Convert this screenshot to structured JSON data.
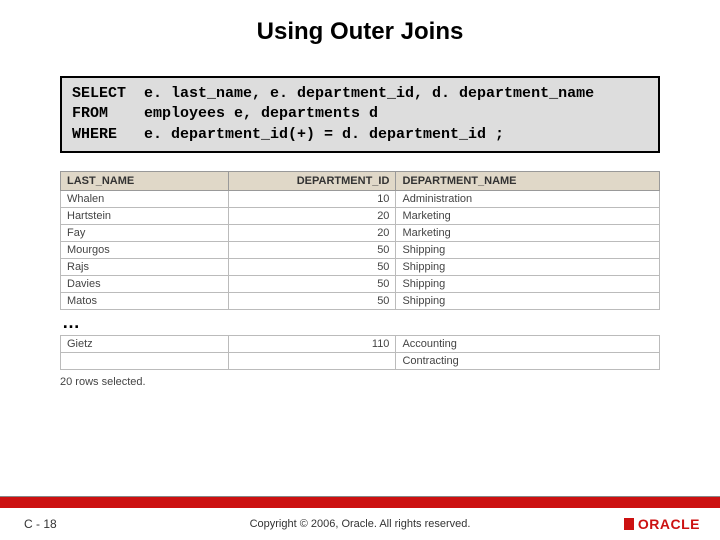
{
  "title": "Using Outer Joins",
  "sql": {
    "select_kw": "SELECT",
    "select_body": "e. last_name, e. department_id, d. department_name",
    "from_kw": "FROM",
    "from_body": "employees e, departments d",
    "where_kw": "WHERE",
    "where_body": "e. department_id(+) = d. department_id ;"
  },
  "chart_data": {
    "type": "table",
    "columns": [
      "LAST_NAME",
      "DEPARTMENT_ID",
      "DEPARTMENT_NAME"
    ],
    "rows_top": [
      {
        "last_name": "Whalen",
        "department_id": 10,
        "department_name": "Administration"
      },
      {
        "last_name": "Hartstein",
        "department_id": 20,
        "department_name": "Marketing"
      },
      {
        "last_name": "Fay",
        "department_id": 20,
        "department_name": "Marketing"
      },
      {
        "last_name": "Mourgos",
        "department_id": 50,
        "department_name": "Shipping"
      },
      {
        "last_name": "Rajs",
        "department_id": 50,
        "department_name": "Shipping"
      },
      {
        "last_name": "Davies",
        "department_id": 50,
        "department_name": "Shipping"
      },
      {
        "last_name": "Matos",
        "department_id": 50,
        "department_name": "Shipping"
      }
    ],
    "ellipsis": "…",
    "rows_bottom": [
      {
        "last_name": "Gietz",
        "department_id": 110,
        "department_name": "Accounting"
      },
      {
        "last_name": "",
        "department_id": "",
        "department_name": "Contracting"
      }
    ],
    "rowcount": "20 rows selected."
  },
  "footer": {
    "page": "C - 18",
    "copyright": "Copyright © 2006, Oracle. All rights reserved.",
    "logo": "ORACLE"
  }
}
